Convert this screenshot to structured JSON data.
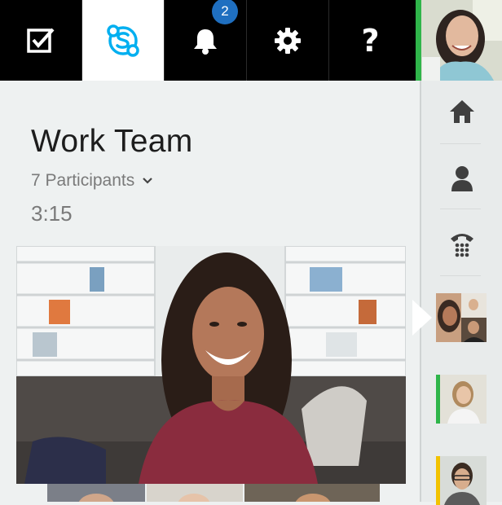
{
  "topbar": {
    "buttons": [
      {
        "name": "tasks",
        "icon": "checkbox-icon"
      },
      {
        "name": "skype",
        "icon": "skype-icon"
      },
      {
        "name": "notifications",
        "icon": "bell-icon",
        "badge": "2"
      },
      {
        "name": "settings",
        "icon": "gear-icon"
      },
      {
        "name": "help",
        "icon": "help-icon",
        "glyph": "?"
      }
    ],
    "self_status_color": "#2fb54a"
  },
  "conversation": {
    "title": "Work Team",
    "participants_label": "7 Participants",
    "timer": "3:15"
  },
  "rail": {
    "items": [
      {
        "name": "home",
        "icon": "home-icon"
      },
      {
        "name": "contacts",
        "icon": "person-icon"
      },
      {
        "name": "dialpad",
        "icon": "phone-icon"
      }
    ],
    "contacts": [
      {
        "name": "group-call",
        "status_color": ""
      },
      {
        "name": "contact-1",
        "status_color": "#2fb54a"
      },
      {
        "name": "contact-2",
        "status_color": "#f2c200"
      }
    ]
  },
  "colors": {
    "skype_blue": "#00aff0",
    "badge_blue": "#1f6fc0",
    "available_green": "#2fb54a",
    "away_yellow": "#f2c200"
  }
}
